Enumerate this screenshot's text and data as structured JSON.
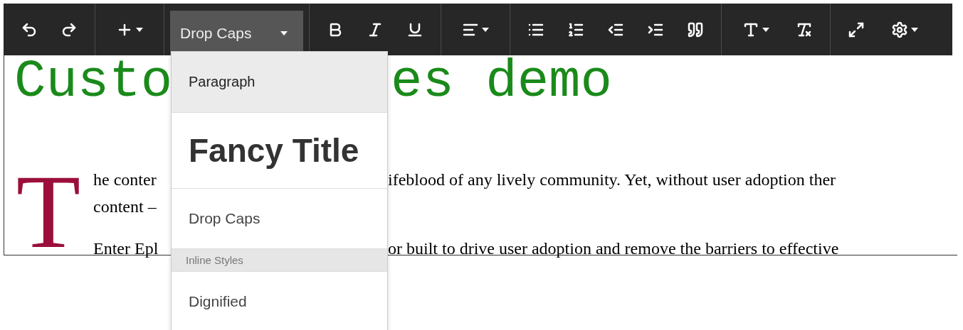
{
  "toolbar": {
    "groups": [
      {
        "buttons": [
          {
            "kind": "icon"
          },
          {
            "kind": "icon"
          }
        ]
      },
      {
        "buttons": [
          {
            "kind": "icon"
          }
        ]
      },
      {
        "buttons": [
          {
            "kind": "select",
            "label": "Drop Caps",
            "open": true
          }
        ]
      },
      {
        "buttons": [
          {
            "kind": "icon"
          },
          {
            "kind": "icon"
          },
          {
            "kind": "icon"
          }
        ]
      },
      {
        "buttons": [
          {
            "kind": "icon"
          }
        ]
      },
      {
        "buttons": [
          {
            "kind": "icon"
          },
          {
            "kind": "icon"
          },
          {
            "kind": "icon"
          },
          {
            "kind": "icon"
          },
          {
            "kind": "icon"
          }
        ]
      },
      {
        "buttons": [
          {
            "kind": "icon"
          },
          {
            "kind": "icon"
          }
        ]
      },
      {
        "buttons": [
          {
            "kind": "icon"
          },
          {
            "kind": "icon"
          }
        ]
      }
    ]
  },
  "style_menu": {
    "items": [
      {
        "kind": "paragraph",
        "label": "Paragraph",
        "highlighted": true
      },
      {
        "kind": "title",
        "label": "Fancy Title",
        "highlighted": false
      },
      {
        "kind": "dropcap",
        "label": "Drop Caps",
        "highlighted": false
      },
      {
        "kind": "header",
        "label": "Inline Styles"
      },
      {
        "kind": "inline",
        "label": "Dignified",
        "highlighted": false
      }
    ]
  },
  "editor": {
    "heading": [
      "Custo",
      "es demo"
    ],
    "drop_cap": "T",
    "paragraphs": [
      {
        "lines": [
          {
            "left": "he conter",
            "right": "ifeblood of any lively community. Yet, without user adoption ther"
          },
          {
            "left": "content –"
          }
        ]
      },
      {
        "lines": [
          {
            "left": "Enter Epl",
            "right": "or built to drive user adoption and remove the barriers to effective"
          }
        ]
      }
    ]
  }
}
